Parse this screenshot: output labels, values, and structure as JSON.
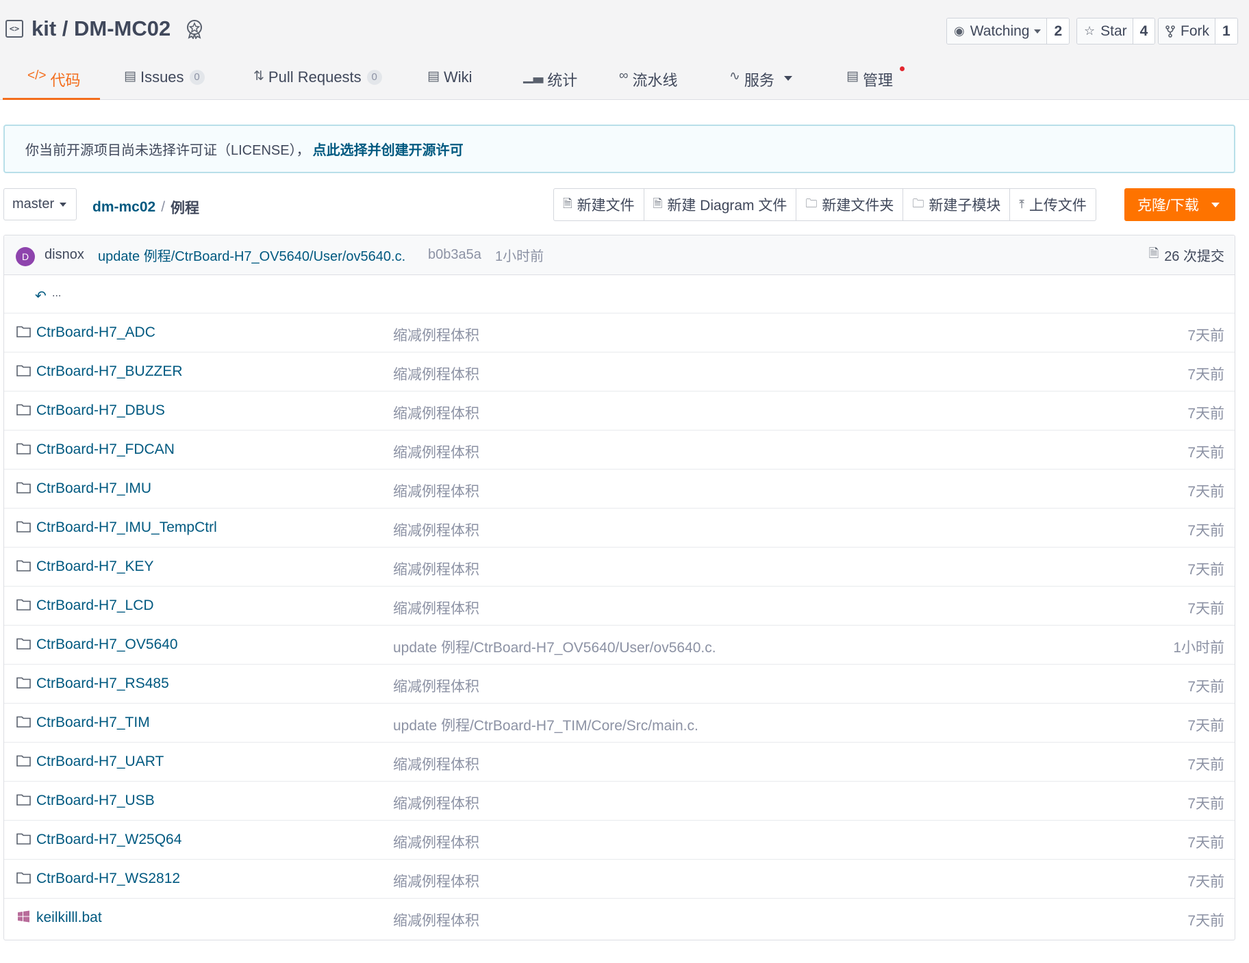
{
  "header": {
    "repo_icon": "<>",
    "repo_name": "kit / DM-MC02",
    "watch": {
      "label": "Watching",
      "count": "2"
    },
    "star": {
      "label": "Star",
      "count": "4"
    },
    "fork": {
      "label": "Fork",
      "count": "1"
    }
  },
  "tabs": [
    {
      "label": "代码",
      "icon": "code-icon",
      "active": true
    },
    {
      "label": "Issues",
      "badge": "0",
      "icon": "issues-icon"
    },
    {
      "label": "Pull Requests",
      "badge": "0",
      "icon": "pull-request-icon"
    },
    {
      "label": "Wiki",
      "icon": "wiki-icon"
    },
    {
      "label": "统计",
      "icon": "stats-icon"
    },
    {
      "label": "流水线",
      "icon": "pipeline-icon"
    },
    {
      "label": "服务",
      "icon": "service-icon"
    },
    {
      "label": "管理",
      "icon": "manage-icon"
    }
  ],
  "notice": {
    "text": "你当前开源项目尚未选择许可证（LICENSE），",
    "link": "点此选择并创建开源许可"
  },
  "toolbar": {
    "branch": "master",
    "breadcrumb_repo": "dm-mc02",
    "breadcrumb_sep": "/",
    "breadcrumb_current": "例程",
    "actions": [
      "新建文件",
      "新建 Diagram 文件",
      "新建文件夹",
      "新建子模块",
      "上传文件"
    ],
    "clone": "克隆/下载"
  },
  "commit": {
    "avatar_letter": "D",
    "author": "disnox",
    "message": "update 例程/CtrBoard-H7_OV5640/User/ov5640.c.",
    "sha": "b0b3a5a",
    "time": "1小时前",
    "count": "26 次提交"
  },
  "back": "...",
  "files": [
    {
      "name": "CtrBoard-H7_ADC",
      "message": "缩减例程体积",
      "time": "7天前",
      "type": "folder"
    },
    {
      "name": "CtrBoard-H7_BUZZER",
      "message": "缩减例程体积",
      "time": "7天前",
      "type": "folder"
    },
    {
      "name": "CtrBoard-H7_DBUS",
      "message": "缩减例程体积",
      "time": "7天前",
      "type": "folder"
    },
    {
      "name": "CtrBoard-H7_FDCAN",
      "message": "缩减例程体积",
      "time": "7天前",
      "type": "folder"
    },
    {
      "name": "CtrBoard-H7_IMU",
      "message": "缩减例程体积",
      "time": "7天前",
      "type": "folder"
    },
    {
      "name": "CtrBoard-H7_IMU_TempCtrl",
      "message": "缩减例程体积",
      "time": "7天前",
      "type": "folder"
    },
    {
      "name": "CtrBoard-H7_KEY",
      "message": "缩减例程体积",
      "time": "7天前",
      "type": "folder"
    },
    {
      "name": "CtrBoard-H7_LCD",
      "message": "缩减例程体积",
      "time": "7天前",
      "type": "folder"
    },
    {
      "name": "CtrBoard-H7_OV5640",
      "message": "update 例程/CtrBoard-H7_OV5640/User/ov5640.c.",
      "time": "1小时前",
      "type": "folder"
    },
    {
      "name": "CtrBoard-H7_RS485",
      "message": "缩减例程体积",
      "time": "7天前",
      "type": "folder"
    },
    {
      "name": "CtrBoard-H7_TIM",
      "message": "update 例程/CtrBoard-H7_TIM/Core/Src/main.c.",
      "time": "7天前",
      "type": "folder"
    },
    {
      "name": "CtrBoard-H7_UART",
      "message": "缩减例程体积",
      "time": "7天前",
      "type": "folder"
    },
    {
      "name": "CtrBoard-H7_USB",
      "message": "缩减例程体积",
      "time": "7天前",
      "type": "folder"
    },
    {
      "name": "CtrBoard-H7_W25Q64",
      "message": "缩减例程体积",
      "time": "7天前",
      "type": "folder"
    },
    {
      "name": "CtrBoard-H7_WS2812",
      "message": "缩减例程体积",
      "time": "7天前",
      "type": "folder"
    },
    {
      "name": "keilkilll.bat",
      "message": "缩减例程体积",
      "time": "7天前",
      "type": "windows-file"
    }
  ],
  "colors": {
    "accent": "#f36d1c",
    "link": "#005980",
    "muted": "#8c92a4",
    "clone_button": "#fe7300"
  }
}
